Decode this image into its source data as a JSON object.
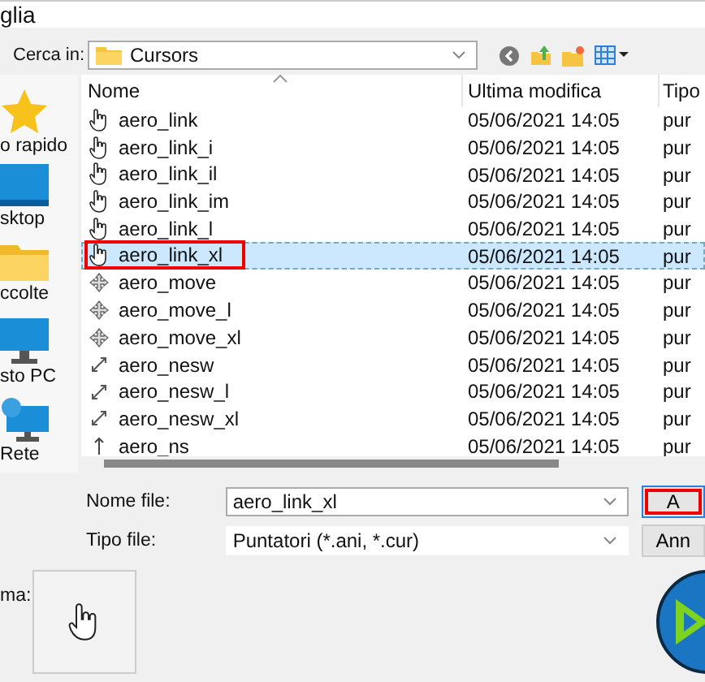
{
  "window": {
    "title": "glia"
  },
  "location": {
    "label": "Cerca in:",
    "value": "Cursors"
  },
  "sidebar": {
    "items": [
      {
        "label": "o rapido",
        "kind": "star"
      },
      {
        "label": "sktop",
        "kind": "desktop"
      },
      {
        "label": "ccolte",
        "kind": "folder"
      },
      {
        "label": "sto PC",
        "kind": "pc"
      },
      {
        "label": "Rete",
        "kind": "network"
      }
    ]
  },
  "table": {
    "columns": [
      "Nome",
      "Ultima modifica",
      "Tipo"
    ],
    "rows": [
      {
        "name": "aero_link",
        "modified": "05/06/2021 14:05",
        "type": "pur",
        "kind": "hand",
        "selected": false,
        "outlined": false
      },
      {
        "name": "aero_link_i",
        "modified": "05/06/2021 14:05",
        "type": "pur",
        "kind": "hand",
        "selected": false,
        "outlined": false
      },
      {
        "name": "aero_link_il",
        "modified": "05/06/2021 14:05",
        "type": "pur",
        "kind": "hand",
        "selected": false,
        "outlined": false
      },
      {
        "name": "aero_link_im",
        "modified": "05/06/2021 14:05",
        "type": "pur",
        "kind": "hand",
        "selected": false,
        "outlined": false
      },
      {
        "name": "aero_link_l",
        "modified": "05/06/2021 14:05",
        "type": "pur",
        "kind": "hand",
        "selected": false,
        "outlined": false
      },
      {
        "name": "aero_link_xl",
        "modified": "05/06/2021 14:05",
        "type": "pur",
        "kind": "hand",
        "selected": true,
        "outlined": true
      },
      {
        "name": "aero_move",
        "modified": "05/06/2021 14:05",
        "type": "pur",
        "kind": "move",
        "selected": false,
        "outlined": false
      },
      {
        "name": "aero_move_l",
        "modified": "05/06/2021 14:05",
        "type": "pur",
        "kind": "move",
        "selected": false,
        "outlined": false
      },
      {
        "name": "aero_move_xl",
        "modified": "05/06/2021 14:05",
        "type": "pur",
        "kind": "move",
        "selected": false,
        "outlined": false
      },
      {
        "name": "aero_nesw",
        "modified": "05/06/2021 14:05",
        "type": "pur",
        "kind": "diagonal",
        "selected": false,
        "outlined": false
      },
      {
        "name": "aero_nesw_l",
        "modified": "05/06/2021 14:05",
        "type": "pur",
        "kind": "diagonal",
        "selected": false,
        "outlined": false
      },
      {
        "name": "aero_nesw_xl",
        "modified": "05/06/2021 14:05",
        "type": "pur",
        "kind": "diagonal",
        "selected": false,
        "outlined": false
      },
      {
        "name": "aero_ns",
        "modified": "05/06/2021 14:05",
        "type": "pur",
        "kind": "vertical",
        "selected": false,
        "outlined": false
      }
    ]
  },
  "filename": {
    "label": "Nome file:",
    "value": "aero_link_xl"
  },
  "filetype": {
    "label": "Tipo file:",
    "value": "Puntatori (*.ani, *.cur)"
  },
  "buttons": [
    {
      "label": "A",
      "outlined": true
    },
    {
      "label": "Ann",
      "outlined": false
    }
  ],
  "preview": {
    "label": "ma:"
  }
}
